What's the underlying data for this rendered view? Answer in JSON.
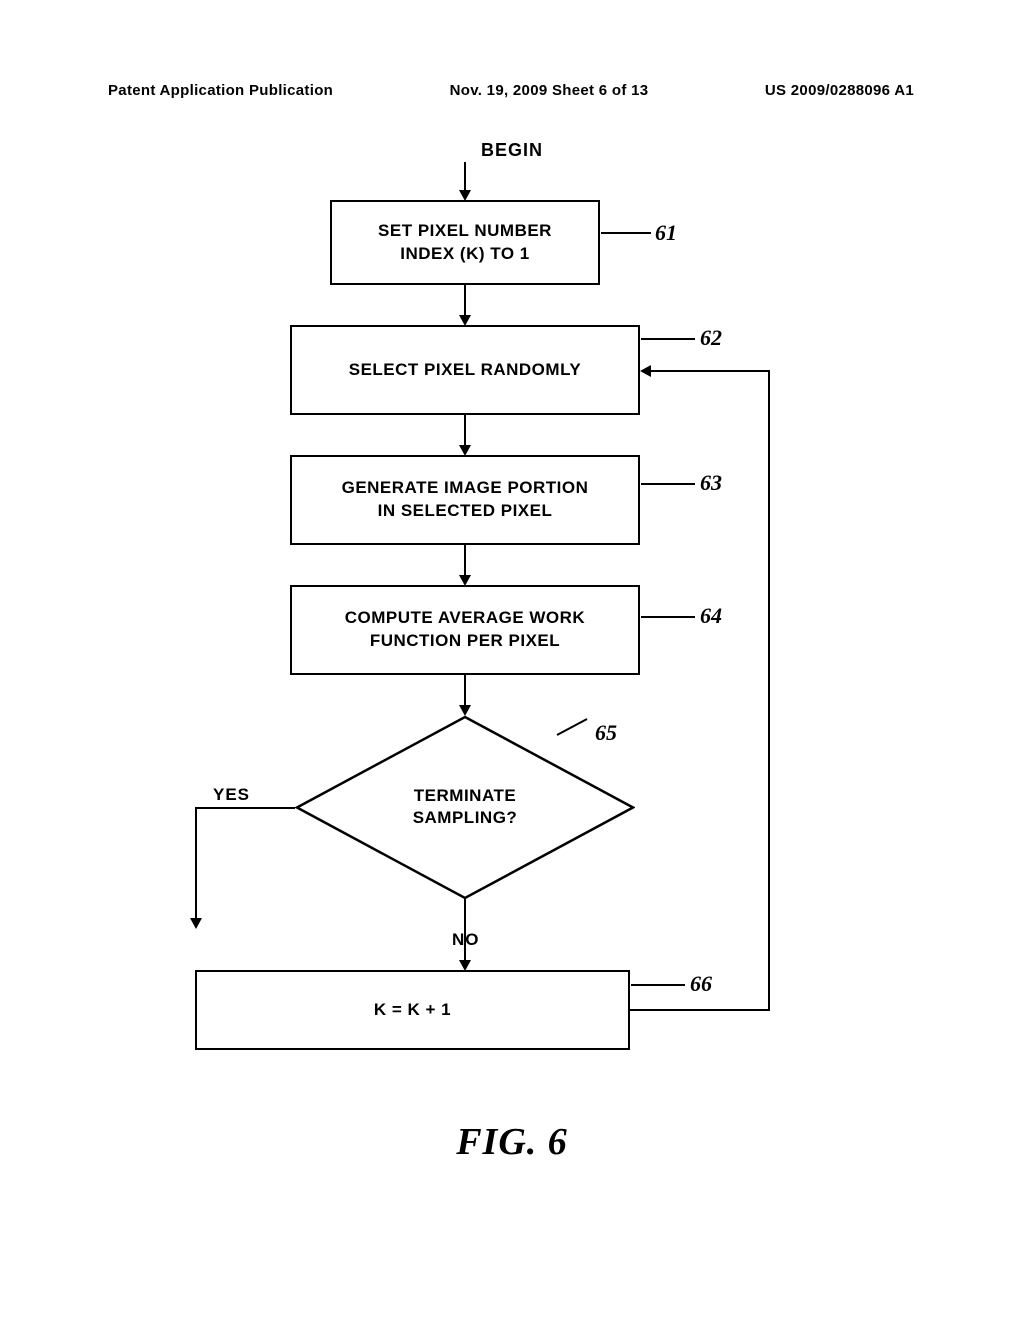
{
  "header": {
    "left": "Patent Application Publication",
    "center": "Nov. 19, 2009  Sheet 6 of 13",
    "right": "US 2009/0288096 A1"
  },
  "flowchart": {
    "begin": "BEGIN",
    "boxes": {
      "b61": "SET PIXEL NUMBER\nINDEX (K) TO 1",
      "b62": "SELECT PIXEL RANDOMLY",
      "b63": "GENERATE IMAGE PORTION\nIN SELECTED PIXEL",
      "b64": "COMPUTE AVERAGE WORK\nFUNCTION PER PIXEL",
      "decision": "TERMINATE\nSAMPLING?",
      "b66": "K = K + 1"
    },
    "labels": {
      "yes": "YES",
      "no": "NO"
    },
    "refs": {
      "r61": "61",
      "r62": "62",
      "r63": "63",
      "r64": "64",
      "r65": "65",
      "r66": "66"
    }
  },
  "figure_label": "FIG.  6",
  "chart_data": {
    "type": "flowchart",
    "title": "FIG. 6",
    "nodes": [
      {
        "id": "begin",
        "type": "start",
        "label": "BEGIN"
      },
      {
        "id": "61",
        "type": "process",
        "label": "SET PIXEL NUMBER INDEX (K) TO 1",
        "ref": "61"
      },
      {
        "id": "62",
        "type": "process",
        "label": "SELECT PIXEL RANDOMLY",
        "ref": "62"
      },
      {
        "id": "63",
        "type": "process",
        "label": "GENERATE IMAGE PORTION IN SELECTED PIXEL",
        "ref": "63"
      },
      {
        "id": "64",
        "type": "process",
        "label": "COMPUTE AVERAGE WORK FUNCTION PER PIXEL",
        "ref": "64"
      },
      {
        "id": "65",
        "type": "decision",
        "label": "TERMINATE SAMPLING?",
        "ref": "65"
      },
      {
        "id": "66",
        "type": "process",
        "label": "K = K + 1",
        "ref": "66"
      }
    ],
    "edges": [
      {
        "from": "begin",
        "to": "61"
      },
      {
        "from": "61",
        "to": "62"
      },
      {
        "from": "62",
        "to": "63"
      },
      {
        "from": "63",
        "to": "64"
      },
      {
        "from": "64",
        "to": "65"
      },
      {
        "from": "65",
        "to": "66",
        "label": "NO"
      },
      {
        "from": "65",
        "to": "exit",
        "label": "YES"
      },
      {
        "from": "66",
        "to": "62"
      }
    ]
  }
}
